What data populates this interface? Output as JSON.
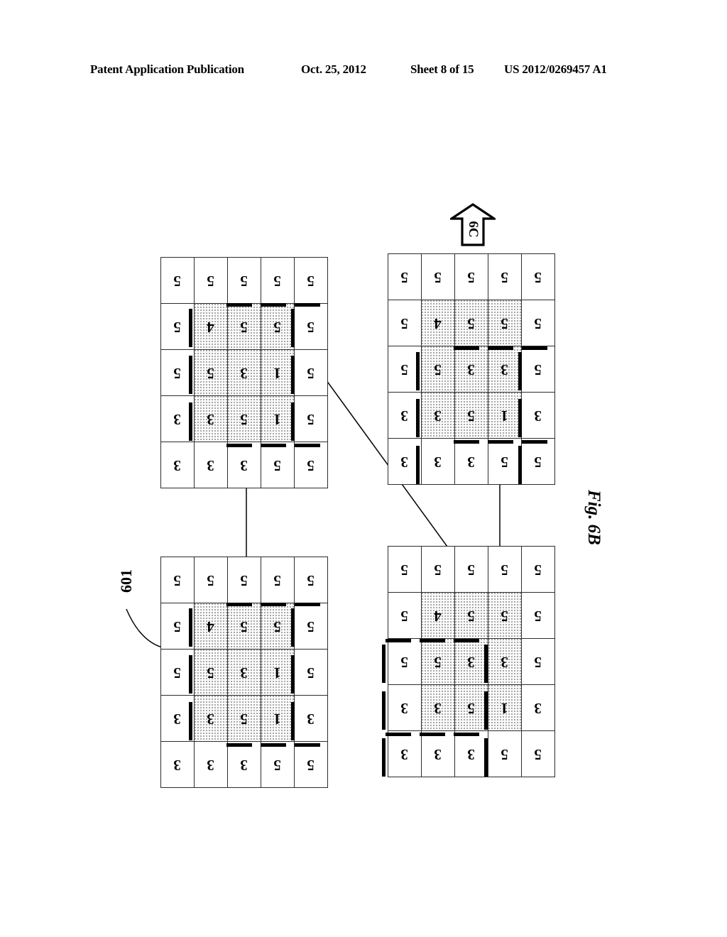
{
  "header": {
    "publication": "Patent Application Publication",
    "date": "Oct. 25, 2012",
    "sheet": "Sheet 8 of 15",
    "patent_number": "US 2012/0269457 A1"
  },
  "figure": {
    "caption": "Fig. 6B",
    "reference_numeral": "601",
    "section_arrow_label": "6C"
  },
  "grids": [
    {
      "id": "grid-top-left",
      "rows": [
        [
          "5",
          "5",
          "5",
          "5",
          "5"
        ],
        [
          "5",
          "5",
          "1",
          "1",
          "5"
        ],
        [
          "5",
          "5",
          "3",
          "5",
          "3"
        ],
        [
          "5",
          "4",
          "5",
          "3",
          "3"
        ],
        [
          "5",
          "5",
          "5",
          "3",
          "3"
        ]
      ],
      "shaded": [
        [
          1,
          1
        ],
        [
          1,
          2
        ],
        [
          1,
          3
        ],
        [
          2,
          1
        ],
        [
          2,
          2
        ],
        [
          2,
          3
        ],
        [
          3,
          1
        ],
        [
          3,
          2
        ],
        [
          3,
          3
        ]
      ]
    },
    {
      "id": "grid-top-right",
      "rows": [
        [
          "5",
          "5",
          "5",
          "3",
          "5"
        ],
        [
          "5",
          "5",
          "3",
          "1",
          "5"
        ],
        [
          "5",
          "5",
          "3",
          "5",
          "3"
        ],
        [
          "5",
          "4",
          "5",
          "3",
          "3"
        ],
        [
          "5",
          "5",
          "5",
          "3",
          "3"
        ]
      ],
      "shaded": [
        [
          1,
          1
        ],
        [
          1,
          2
        ],
        [
          1,
          3
        ],
        [
          2,
          1
        ],
        [
          2,
          2
        ],
        [
          2,
          3
        ],
        [
          3,
          1
        ],
        [
          3,
          2
        ],
        [
          3,
          3
        ]
      ]
    },
    {
      "id": "grid-bottom-left",
      "rows": [
        [
          "5",
          "5",
          "5",
          "3",
          "5"
        ],
        [
          "5",
          "5",
          "1",
          "1",
          "5"
        ],
        [
          "5",
          "5",
          "3",
          "5",
          "3"
        ],
        [
          "5",
          "4",
          "5",
          "3",
          "3"
        ],
        [
          "5",
          "5",
          "5",
          "3",
          "3"
        ]
      ],
      "shaded": [
        [
          1,
          1
        ],
        [
          1,
          2
        ],
        [
          1,
          3
        ],
        [
          2,
          1
        ],
        [
          2,
          2
        ],
        [
          2,
          3
        ],
        [
          3,
          1
        ],
        [
          3,
          2
        ],
        [
          3,
          3
        ]
      ]
    },
    {
      "id": "grid-bottom-right",
      "rows": [
        [
          "5",
          "5",
          "5",
          "3",
          "5"
        ],
        [
          "5",
          "5",
          "3",
          "1",
          "5"
        ],
        [
          "5",
          "5",
          "3",
          "5",
          "3"
        ],
        [
          "5",
          "4",
          "5",
          "3",
          "3"
        ],
        [
          "5",
          "5",
          "5",
          "3",
          "3"
        ]
      ],
      "shaded": [
        [
          1,
          1
        ],
        [
          1,
          2
        ],
        [
          1,
          3
        ],
        [
          2,
          1
        ],
        [
          2,
          2
        ],
        [
          2,
          3
        ],
        [
          3,
          1
        ],
        [
          3,
          2
        ],
        [
          3,
          3
        ]
      ]
    }
  ],
  "colors": {
    "ink": "#000000",
    "rule": "#2c2c2c",
    "stipple": "#9a9a9a",
    "page": "#ffffff"
  }
}
